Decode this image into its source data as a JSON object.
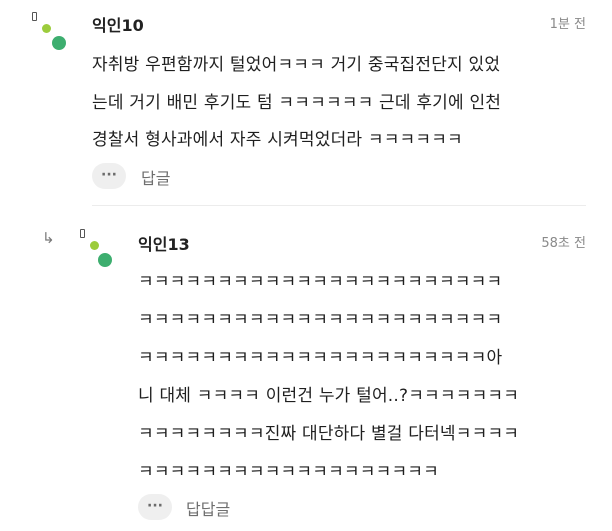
{
  "comments": [
    {
      "author": "익인10",
      "time": "1분 전",
      "lines": [
        "자취방 우편함까지 털었어ㅋㅋㅋ 거기 중국집전단지 있었",
        "는데 거기 배민 후기도 텀 ㅋㅋㅋㅋㅋㅋ 근데 후기에 인천",
        "경찰서 형사과에서 자주 시켜먹었더라 ㅋㅋㅋㅋㅋㅋ"
      ],
      "more_label": "···",
      "reply_label": "답글"
    },
    {
      "author": "익인13",
      "time": "58초 전",
      "reply_icon": "reply-arrow-icon",
      "lines": [
        "ㅋㅋㅋㅋㅋㅋㅋㅋㅋㅋㅋㅋㅋㅋㅋㅋㅋㅋㅋㅋㅋㅋㅋ",
        "ㅋㅋㅋㅋㅋㅋㅋㅋㅋㅋㅋㅋㅋㅋㅋㅋㅋㅋㅋㅋㅋㅋㅋ",
        "ㅋㅋㅋㅋㅋㅋㅋㅋㅋㅋㅋㅋㅋㅋㅋㅋㅋㅋㅋㅋㅋㅋ아",
        "니 대체 ㅋㅋㅋㅋ 이런건 누가 털어..?ㅋㅋㅋㅋㅋㅋㅋ",
        "ㅋㅋㅋㅋㅋㅋㅋㅋ진짜 대단하다 별걸 다터넥ㅋㅋㅋㅋ",
        "ㅋㅋㅋㅋㅋㅋㅋㅋㅋㅋㅋㅋㅋㅋㅋㅋㅋㅋㅋ"
      ],
      "more_label": "···",
      "reply_label": "답답글"
    }
  ],
  "colors": {
    "avatar_lime": "#9ccc3c",
    "avatar_green": "#3dae6f",
    "divider": "#ececec"
  }
}
